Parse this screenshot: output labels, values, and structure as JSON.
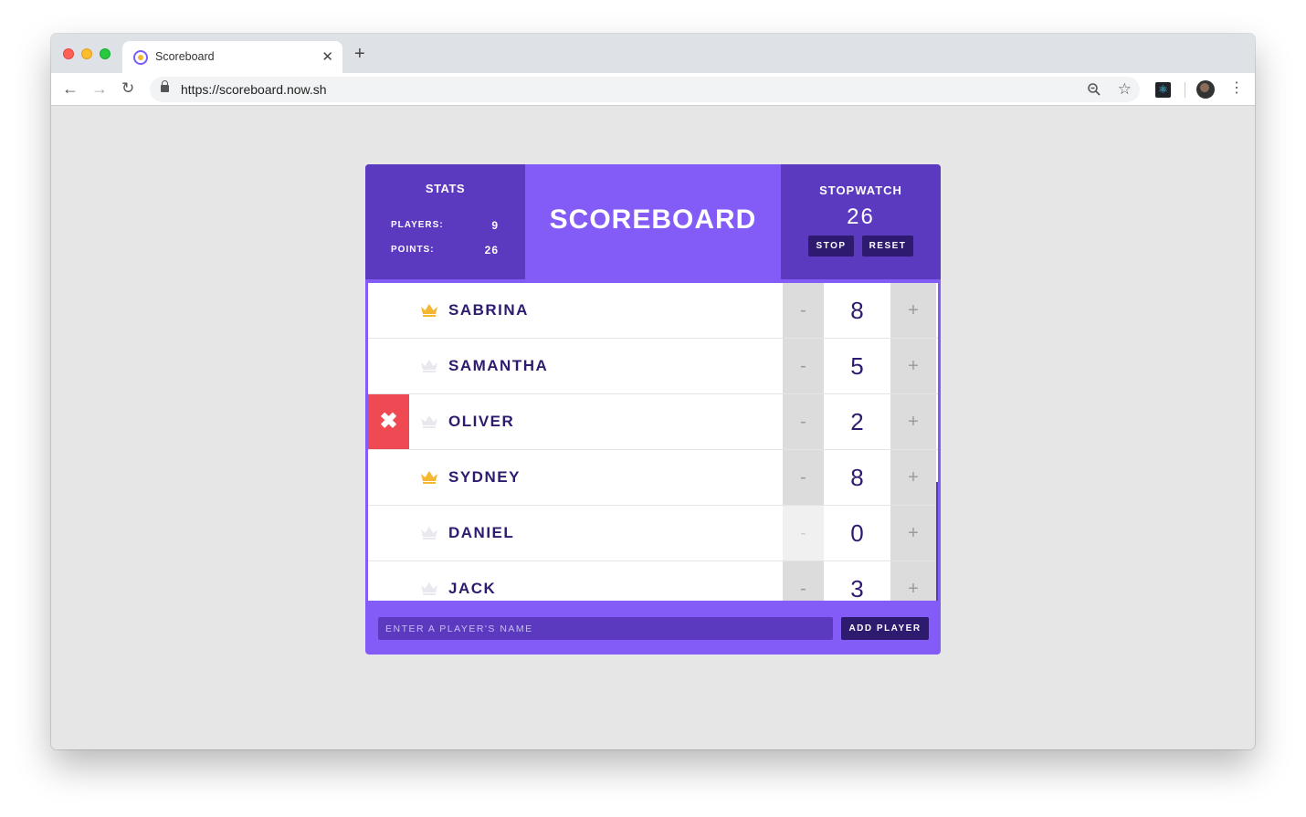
{
  "browser": {
    "tab_title": "Scoreboard",
    "tab_close": "✕",
    "new_tab": "+",
    "url": "https://scoreboard.now.sh",
    "icons": [
      "back-icon",
      "forward-icon",
      "reload-icon",
      "lock-icon",
      "zoom-icon",
      "star-icon",
      "react-devtools-icon",
      "avatar",
      "menu-icon"
    ]
  },
  "colors": {
    "accent": "#835cf7",
    "panel": "#5b3abf",
    "dark": "#2e1a6e",
    "remove": "#ef4a53",
    "crown_active": "#f5b731",
    "crown_inactive": "#e8e8ee"
  },
  "stats": {
    "title": "STATS",
    "players_label": "PLAYERS:",
    "players_value": "9",
    "points_label": "POINTS:",
    "points_value": "26"
  },
  "app_title": "SCOREBOARD",
  "stopwatch": {
    "title": "STOPWATCH",
    "time": "26",
    "stop_label": "STOP",
    "reset_label": "RESET"
  },
  "players": [
    {
      "name": "SABRINA",
      "score": "8",
      "leader": true,
      "dec": "-",
      "inc": "+"
    },
    {
      "name": "SAMANTHA",
      "score": "5",
      "leader": false,
      "dec": "-",
      "inc": "+"
    },
    {
      "name": "OLIVER",
      "score": "2",
      "leader": false,
      "dec": "-",
      "inc": "+",
      "remove": "✖"
    },
    {
      "name": "SYDNEY",
      "score": "8",
      "leader": true,
      "dec": "-",
      "inc": "+"
    },
    {
      "name": "DANIEL",
      "score": "0",
      "leader": false,
      "dec": "-",
      "inc": "+"
    },
    {
      "name": "JACK",
      "score": "3",
      "leader": false,
      "dec": "-",
      "inc": "+"
    }
  ],
  "footer": {
    "placeholder": "ENTER A PLAYER'S NAME",
    "add_label": "ADD PLAYER"
  }
}
